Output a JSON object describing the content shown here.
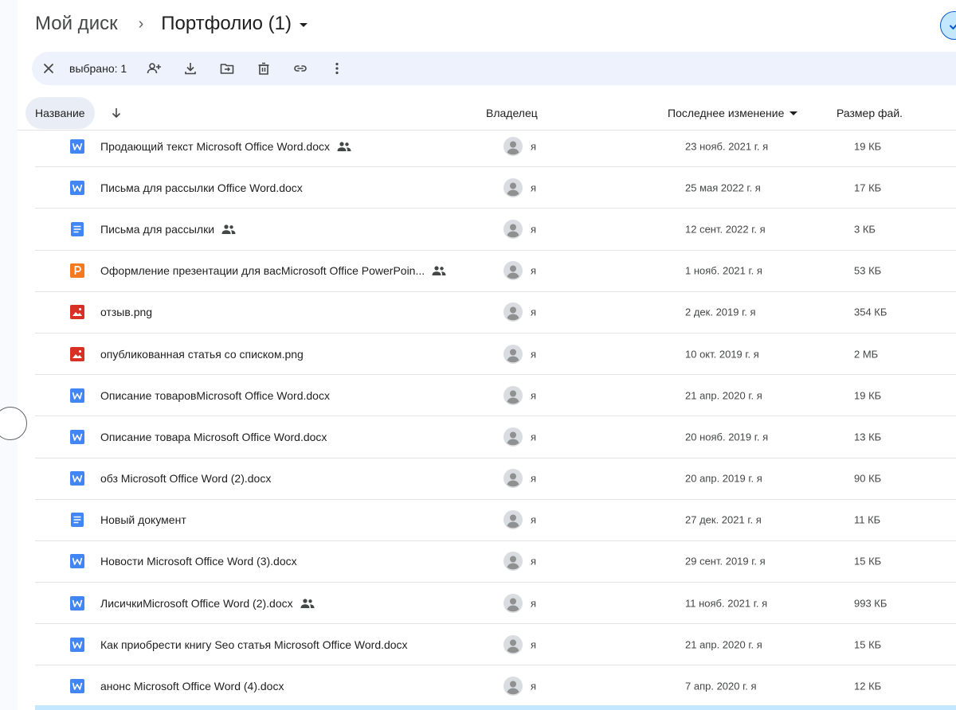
{
  "breadcrumb": {
    "root": "Мой диск",
    "separator": "›",
    "current": "Портфолио (1)"
  },
  "toolbar": {
    "selected_count": "выбрано: 1",
    "icons": [
      "close-icon",
      "share-icon",
      "download-icon",
      "move-icon",
      "trash-icon",
      "link-icon",
      "more-icon"
    ]
  },
  "header": {
    "name": "Название",
    "owner": "Владелец",
    "modified": "Последнее изменение",
    "size": "Размер фай."
  },
  "colors": {
    "word": "#4285f4",
    "docs": "#4285f4",
    "slides": "#f4791f",
    "image": "#d93025",
    "toolbar_bg": "#edf2fc",
    "accent": "#0b57d0"
  },
  "files": [
    {
      "type": "word",
      "name": "Продающий текст Microsoft Office Word.docx",
      "shared": true,
      "owner": "я",
      "modified": "23 нояб. 2021 г. я",
      "size": "19 КБ"
    },
    {
      "type": "word",
      "name": "Письма для рассылки Office Word.docx",
      "shared": false,
      "owner": "я",
      "modified": "25 мая 2022 г. я",
      "size": "17 КБ"
    },
    {
      "type": "docs",
      "name": "Письма для рассылки",
      "shared": true,
      "owner": "я",
      "modified": "12 сент. 2022 г. я",
      "size": "3 КБ"
    },
    {
      "type": "slides",
      "name": "Оформление презентации для васMicrosoft Office PowerPoin...",
      "shared": true,
      "owner": "я",
      "modified": "1 нояб. 2021 г. я",
      "size": "53 КБ"
    },
    {
      "type": "image",
      "name": "отзыв.png",
      "shared": false,
      "owner": "я",
      "modified": "2 дек. 2019 г. я",
      "size": "354 КБ"
    },
    {
      "type": "image",
      "name": "опубликованная статья со списком.png",
      "shared": false,
      "owner": "я",
      "modified": "10 окт. 2019 г. я",
      "size": "2 МБ"
    },
    {
      "type": "word",
      "name": "Описание товаровMicrosoft Office Word.docx",
      "shared": false,
      "owner": "я",
      "modified": "21 апр. 2020 г. я",
      "size": "19 КБ"
    },
    {
      "type": "word",
      "name": "Описание товара  Microsoft Office Word.docx",
      "shared": false,
      "owner": "я",
      "modified": "20 нояб. 2019 г. я",
      "size": "13 КБ"
    },
    {
      "type": "word",
      "name": "обз Microsoft Office Word (2).docx",
      "shared": false,
      "owner": "я",
      "modified": "20 апр. 2019 г. я",
      "size": "90 КБ"
    },
    {
      "type": "docs",
      "name": "Новый документ",
      "shared": false,
      "owner": "я",
      "modified": "27 дек. 2021 г. я",
      "size": "11 КБ"
    },
    {
      "type": "word",
      "name": "Новости Microsoft Office Word (3).docx",
      "shared": false,
      "owner": "я",
      "modified": "29 сент. 2019 г. я",
      "size": "15 КБ"
    },
    {
      "type": "word",
      "name": "ЛисичкиMicrosoft Office Word (2).docx",
      "shared": true,
      "owner": "я",
      "modified": "11 нояб. 2021 г. я",
      "size": "993 КБ"
    },
    {
      "type": "word",
      "name": "Как приобрести книгу Seo статья Microsoft Office Word.docx",
      "shared": false,
      "owner": "я",
      "modified": "21 апр. 2020 г. я",
      "size": "15 КБ"
    },
    {
      "type": "word",
      "name": "анонс Microsoft Office Word (4).docx",
      "shared": false,
      "owner": "я",
      "modified": "7 апр. 2020 г. я",
      "size": "12 КБ"
    }
  ]
}
